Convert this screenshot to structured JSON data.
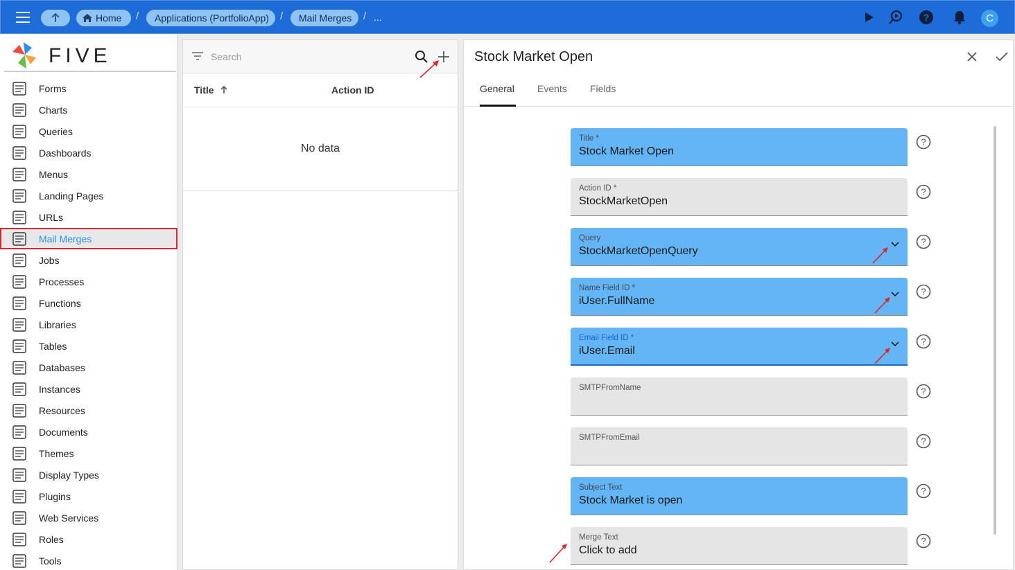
{
  "topbar": {
    "breadcrumbs": [
      "Home",
      "Applications (PortfolioApp)",
      "Mail Merges",
      "..."
    ],
    "separator": "/",
    "avatar_letter": "C",
    "color": "#1e6cd8"
  },
  "sidebar": {
    "logo_text": "FIVE",
    "items": [
      {
        "label": "Forms",
        "icon": "forms-icon"
      },
      {
        "label": "Charts",
        "icon": "charts-icon"
      },
      {
        "label": "Queries",
        "icon": "queries-icon"
      },
      {
        "label": "Dashboards",
        "icon": "dashboards-icon"
      },
      {
        "label": "Menus",
        "icon": "menus-icon"
      },
      {
        "label": "Landing Pages",
        "icon": "landing-pages-icon"
      },
      {
        "label": "URLs",
        "icon": "globe-icon"
      },
      {
        "label": "Mail Merges",
        "icon": "mail-merge-icon"
      },
      {
        "label": "Jobs",
        "icon": "jobs-icon"
      },
      {
        "label": "Processes",
        "icon": "processes-icon"
      },
      {
        "label": "Functions",
        "icon": "function-icon"
      },
      {
        "label": "Libraries",
        "icon": "libraries-icon"
      },
      {
        "label": "Tables",
        "icon": "tables-icon"
      },
      {
        "label": "Databases",
        "icon": "database-icon"
      },
      {
        "label": "Instances",
        "icon": "instances-icon"
      },
      {
        "label": "Resources",
        "icon": "resources-icon"
      },
      {
        "label": "Documents",
        "icon": "documents-icon"
      },
      {
        "label": "Themes",
        "icon": "themes-icon"
      },
      {
        "label": "Display Types",
        "icon": "display-types-icon"
      },
      {
        "label": "Plugins",
        "icon": "plugins-icon"
      },
      {
        "label": "Web Services",
        "icon": "api-icon"
      },
      {
        "label": "Roles",
        "icon": "roles-icon"
      },
      {
        "label": "Tools",
        "icon": "tools-icon"
      }
    ],
    "active_label": "Mail Merges"
  },
  "list": {
    "search_placeholder": "Search",
    "col_title": "Title",
    "col_action": "Action ID",
    "empty": "No data"
  },
  "form": {
    "title": "Stock Market Open",
    "tabs": [
      "General",
      "Events",
      "Fields"
    ],
    "fields": [
      {
        "label": "Title *",
        "value": "Stock Market Open",
        "style": "blue"
      },
      {
        "label": "Action ID *",
        "value": "StockMarketOpen",
        "style": "grey"
      },
      {
        "label": "Query",
        "value": "StockMarketOpenQuery",
        "style": "blue",
        "dropdown": true
      },
      {
        "label": "Name Field ID *",
        "value": "iUser.FullName",
        "style": "blue",
        "dropdown": true
      },
      {
        "label": "Email Field ID *",
        "value": "iUser.Email",
        "style": "blue",
        "dropdown": true,
        "focused": true
      },
      {
        "label": "SMTPFromName",
        "value": "",
        "style": "grey"
      },
      {
        "label": "SMTPFromEmail",
        "value": "",
        "style": "grey"
      },
      {
        "label": "Subject Text",
        "value": "Stock Market is open",
        "style": "blue"
      },
      {
        "label": "Merge Text",
        "value": "Click to add",
        "style": "grey"
      }
    ]
  },
  "colors": {
    "accent": "#2b8ef0",
    "field_blue": "#64b5f6",
    "annotation_red": "#e0242c"
  }
}
